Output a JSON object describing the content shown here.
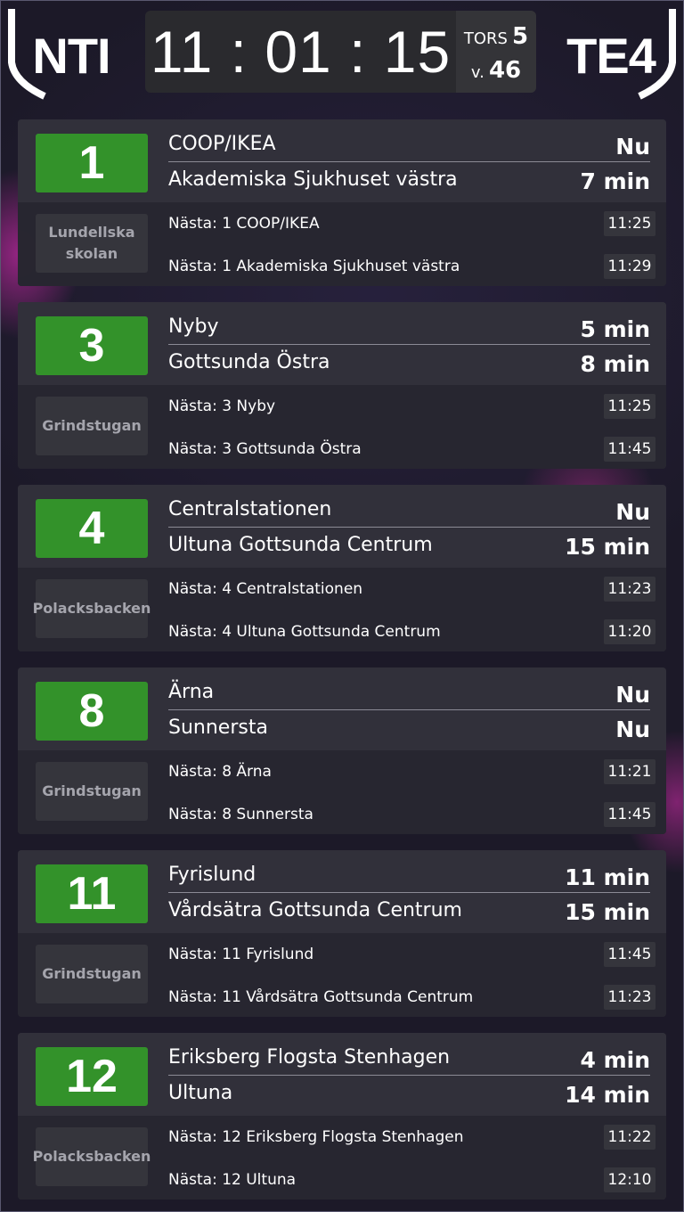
{
  "header": {
    "logo_left": "NTI",
    "logo_right": "TE4",
    "clock": "11 : 01 : 15",
    "day_label": "TORS",
    "day_number": "5",
    "week_label": "v.",
    "week_number": "46"
  },
  "departures": [
    {
      "line": "1",
      "stop": "Lundellska skolan",
      "dest1": "COOP/IKEA",
      "eta1": "Nu",
      "dest2": "Akademiska Sjukhuset västra",
      "eta2": "7 min",
      "next1": "Nästa: 1 COOP/IKEA",
      "time1": "11:25",
      "next2": "Nästa: 1 Akademiska Sjukhuset västra",
      "time2": "11:29"
    },
    {
      "line": "3",
      "stop": "Grindstugan",
      "dest1": "Nyby",
      "eta1": "5 min",
      "dest2": "Gottsunda Östra",
      "eta2": "8 min",
      "next1": "Nästa: 3 Nyby",
      "time1": "11:25",
      "next2": "Nästa: 3 Gottsunda Östra",
      "time2": "11:45"
    },
    {
      "line": "4",
      "stop": "Polacksbacken",
      "dest1": "Centralstationen",
      "eta1": "Nu",
      "dest2": "Ultuna Gottsunda Centrum",
      "eta2": "15 min",
      "next1": "Nästa: 4 Centralstationen",
      "time1": "11:23",
      "next2": "Nästa: 4 Ultuna Gottsunda Centrum",
      "time2": "11:20"
    },
    {
      "line": "8",
      "stop": "Grindstugan",
      "dest1": "Ärna",
      "eta1": "Nu",
      "dest2": "Sunnersta",
      "eta2": "Nu",
      "next1": "Nästa: 8 Ärna",
      "time1": "11:21",
      "next2": "Nästa: 8 Sunnersta",
      "time2": "11:45"
    },
    {
      "line": "11",
      "stop": "Grindstugan",
      "dest1": "Fyrislund",
      "eta1": "11 min",
      "dest2": "Vårdsätra Gottsunda Centrum",
      "eta2": "15 min",
      "next1": "Nästa: 11 Fyrislund",
      "time1": "11:45",
      "next2": "Nästa: 11 Vårdsätra Gottsunda Centrum",
      "time2": "11:23"
    },
    {
      "line": "12",
      "stop": "Polacksbacken",
      "dest1": "Eriksberg Flogsta Stenhagen",
      "eta1": "4 min",
      "dest2": "Ultuna",
      "eta2": "14 min",
      "next1": "Nästa: 12 Eriksberg Flogsta Stenhagen",
      "time1": "11:22",
      "next2": "Nästa: 12 Ultuna",
      "time2": "12:10"
    }
  ],
  "colors": {
    "line_badge": "#33922a",
    "card_bg": "#2c2b34",
    "page_bg": "#1c1928",
    "accent_glow": "#be28a0"
  }
}
